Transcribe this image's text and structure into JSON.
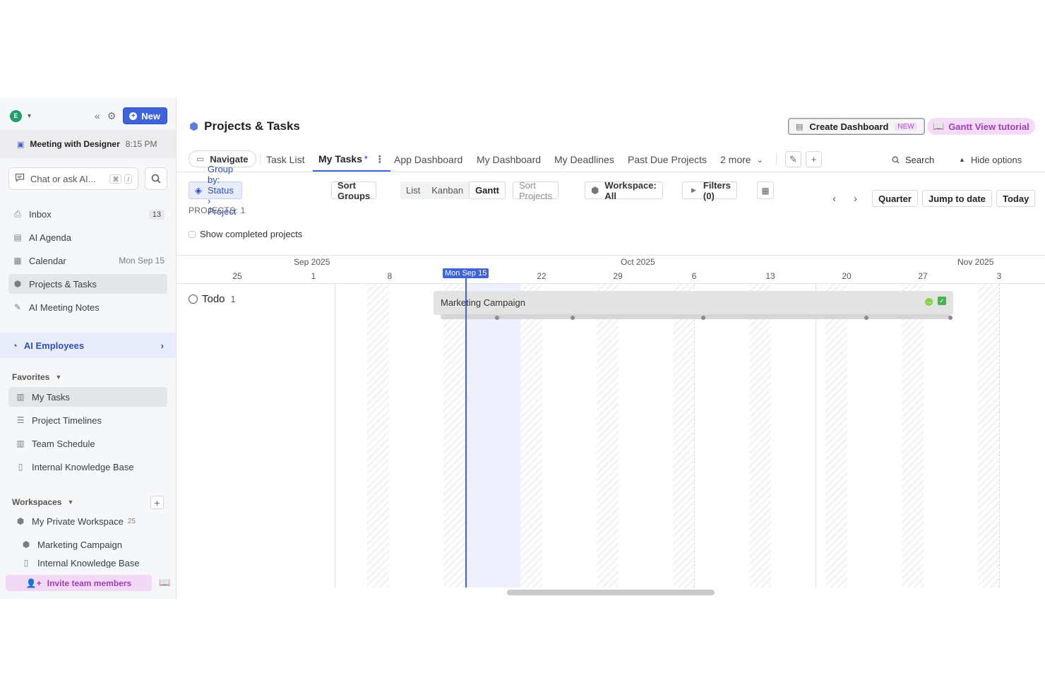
{
  "sidebar": {
    "avatar_letter": "E",
    "new_label": "New",
    "meeting": {
      "title": "Meeting with Designer",
      "time": "8:15 PM"
    },
    "chat_placeholder": "Chat or ask AI...",
    "chat_kbd1": "⌘",
    "chat_kbd2": "/",
    "nav": [
      {
        "label": "Inbox",
        "right": "13",
        "icon": "inbox-icon"
      },
      {
        "label": "AI Agenda",
        "right": "",
        "icon": "agenda-icon"
      },
      {
        "label": "Calendar",
        "right": "Mon Sep 15",
        "icon": "calendar-icon"
      },
      {
        "label": "Projects & Tasks",
        "right": "",
        "icon": "cube-icon"
      },
      {
        "label": "AI Meeting Notes",
        "right": "",
        "icon": "notes-icon"
      }
    ],
    "ai_employees": "AI Employees",
    "favorites_title": "Favorites",
    "favorites": [
      "My Tasks",
      "Project Timelines",
      "Team Schedule",
      "Internal Knowledge Base"
    ],
    "workspaces_title": "Workspaces",
    "workspaces": [
      {
        "label": "My Private Workspace",
        "count": "25"
      },
      {
        "label": "Marketing Campaign",
        "count": ""
      },
      {
        "label": "Internal Knowledge Base",
        "count": ""
      }
    ],
    "invite_label": "Invite team members"
  },
  "header": {
    "title": "Projects & Tasks",
    "create_dashboard": "Create Dashboard",
    "new_tag": "NEW",
    "gantt_tutorial": "Gantt View tutorial"
  },
  "tabs": {
    "navigate": "Navigate",
    "items": [
      "Task List",
      "My Tasks",
      "App Dashboard",
      "My Dashboard",
      "My Deadlines",
      "Past Due Projects"
    ],
    "active_star": "*",
    "more": "2 more",
    "search": "Search",
    "hide_options": "Hide options"
  },
  "toolbar": {
    "group_by": "Group by: Status › Project",
    "sort_groups": "Sort Groups",
    "views": [
      "List",
      "Kanban",
      "Gantt"
    ],
    "selected_view": "Gantt",
    "sort_projects": "Sort Projects",
    "workspace": "Workspace: All",
    "filters": "Filters (0)",
    "quarter": "Quarter",
    "jump_to_date": "Jump to date",
    "today": "Today"
  },
  "projects_count": "PROJECTS: 1",
  "show_completed": "Show completed projects",
  "gantt": {
    "months": [
      "Sep 2025",
      "Oct 2025",
      "Nov 2025"
    ],
    "days": [
      "25",
      "1",
      "8",
      "15",
      "22",
      "29",
      "6",
      "13",
      "20",
      "27",
      "3"
    ],
    "today_tag": "Mon Sep 15",
    "group": {
      "label": "Todo",
      "count": "1"
    },
    "bar_label": "Marketing Campaign"
  },
  "colors": {
    "accent": "#3f63d8",
    "invite": "#a33db8",
    "bar": "#e3e3e4"
  }
}
